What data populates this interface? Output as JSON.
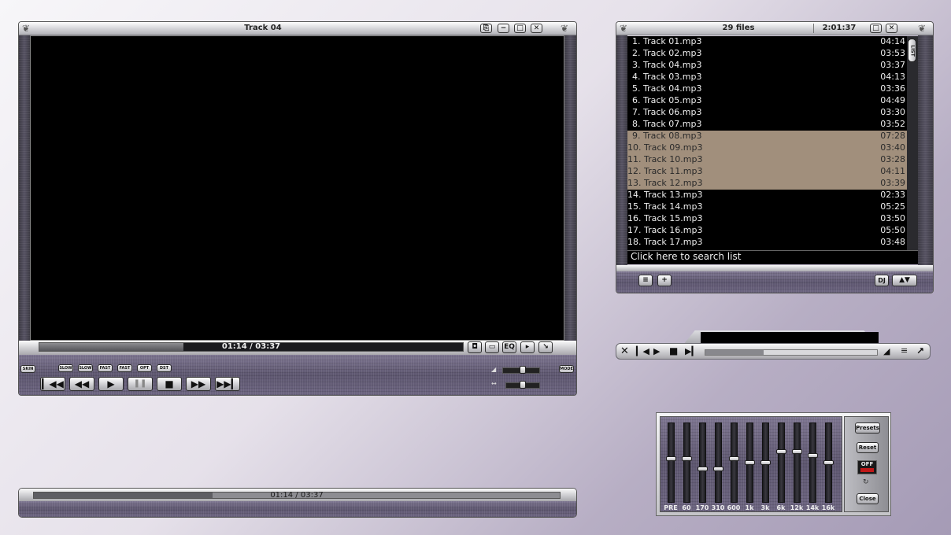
{
  "main": {
    "title": "Track 04",
    "time": "01:14 / 03:37",
    "progress_fraction": 0.34,
    "volume_level": 0.55,
    "balance_level": 0.5,
    "left_buttons": [
      "SKIN"
    ],
    "speed_buttons": [
      "SLOW",
      "SLOW",
      "FAST",
      "FAST",
      "OPT",
      "DST"
    ],
    "mode_label": "MODE",
    "panel_buttons": [
      "◘",
      "▭",
      "EQ",
      "▸",
      "↘"
    ],
    "win_buttons": [
      "⎘",
      "−",
      "□",
      "✕"
    ],
    "transport_icons": [
      "prev",
      "rewind",
      "play",
      "pause",
      "stop",
      "forward",
      "next"
    ]
  },
  "playlist": {
    "count_label": "29 files",
    "total_time": "2:01:37",
    "scroll_label": "LIST",
    "search_placeholder": "Click here to search list",
    "dj_label": "DJ",
    "win_buttons": [
      "□",
      "✕"
    ],
    "tracks": [
      {
        "num": "1.",
        "name": "Track 01.mp3",
        "dur": "04:14",
        "selected": false
      },
      {
        "num": "2.",
        "name": "Track 02.mp3",
        "dur": "03:53",
        "selected": false
      },
      {
        "num": "3.",
        "name": "Track 04.mp3",
        "dur": "03:37",
        "selected": false
      },
      {
        "num": "4.",
        "name": "Track 03.mp3",
        "dur": "04:13",
        "selected": false
      },
      {
        "num": "5.",
        "name": "Track 04.mp3",
        "dur": "03:36",
        "selected": false
      },
      {
        "num": "6.",
        "name": "Track 05.mp3",
        "dur": "04:49",
        "selected": false
      },
      {
        "num": "7.",
        "name": "Track 06.mp3",
        "dur": "03:30",
        "selected": false
      },
      {
        "num": "8.",
        "name": "Track 07.mp3",
        "dur": "03:52",
        "selected": false
      },
      {
        "num": "9.",
        "name": "Track 08.mp3",
        "dur": "07:28",
        "selected": true
      },
      {
        "num": "10.",
        "name": "Track 09.mp3",
        "dur": "03:40",
        "selected": true
      },
      {
        "num": "11.",
        "name": "Track 10.mp3",
        "dur": "03:28",
        "selected": true
      },
      {
        "num": "12.",
        "name": "Track 11.mp3",
        "dur": "04:11",
        "selected": true
      },
      {
        "num": "13.",
        "name": "Track 12.mp3",
        "dur": "03:39",
        "selected": true
      },
      {
        "num": "14.",
        "name": "Track 13.mp3",
        "dur": "02:33",
        "selected": false
      },
      {
        "num": "15.",
        "name": "Track 14.mp3",
        "dur": "05:25",
        "selected": false
      },
      {
        "num": "16.",
        "name": "Track 15.mp3",
        "dur": "03:50",
        "selected": false
      },
      {
        "num": "17.",
        "name": "Track 16.mp3",
        "dur": "05:50",
        "selected": false
      },
      {
        "num": "18.",
        "name": "Track 17.mp3",
        "dur": "03:48",
        "selected": false
      }
    ]
  },
  "mini": {
    "progress_fraction": 0.34,
    "icons": [
      "close",
      "prev",
      "play",
      "stop",
      "next",
      "volume",
      "playlist",
      "restore"
    ]
  },
  "eq": {
    "bands": [
      {
        "label": "PRE",
        "level": 0.55
      },
      {
        "label": "60",
        "level": 0.55
      },
      {
        "label": "170",
        "level": 0.42
      },
      {
        "label": "310",
        "level": 0.42
      },
      {
        "label": "600",
        "level": 0.55
      },
      {
        "label": "1k",
        "level": 0.5
      },
      {
        "label": "3k",
        "level": 0.5
      },
      {
        "label": "6k",
        "level": 0.65
      },
      {
        "label": "12k",
        "level": 0.65
      },
      {
        "label": "14k",
        "level": 0.6
      },
      {
        "label": "16k",
        "level": 0.5
      }
    ],
    "presets_label": "Presets",
    "reset_label": "Reset",
    "toggle_label": "OFF",
    "close_label": "Close"
  },
  "compact": {
    "time": "01:14 / 03:37",
    "progress_fraction": 0.34
  },
  "colors": {
    "selection": "#a18f7c",
    "video_bg": "#000000",
    "frame_purple": "#6a6380"
  }
}
